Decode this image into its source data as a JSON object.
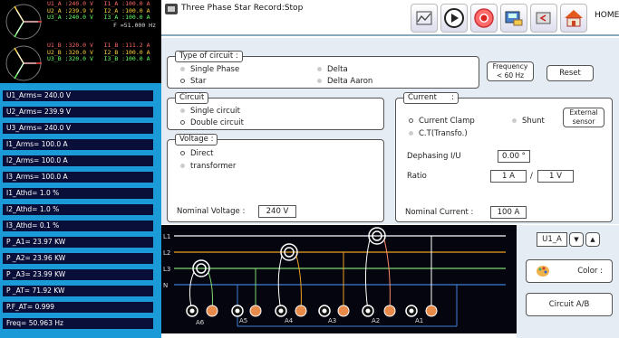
{
  "window": {
    "title": "Three Phase Star Record:Stop",
    "home_label": "HOME"
  },
  "toolbar": {
    "buttons": [
      {
        "name": "chart-icon",
        "symbol": "⚟"
      },
      {
        "name": "play-icon",
        "symbol": "▶"
      },
      {
        "name": "record-icon",
        "symbol": "●"
      },
      {
        "name": "save-icon",
        "symbol": "▤"
      },
      {
        "name": "exit-icon",
        "symbol": "⎋"
      },
      {
        "name": "home-icon",
        "symbol": "⌂"
      }
    ]
  },
  "phasor_top": {
    "lines": [
      "U1_A :240.0 V   I1_A :100.0 A",
      "U2_A :239.9 V   I2_A :100.0 A",
      "U3_A :240.0 V   I3_A :100.0 A"
    ],
    "freq": "F =51.000 Hz"
  },
  "phasor_bottom": {
    "lines": [
      "U1_B :320.0 V   I1_B :111.2 A",
      "U2_B :320.0 V   I2_B :100.0 A",
      "U3_B :320.0 V   I3_B :100.0 A"
    ]
  },
  "measurements": [
    "U1_Arms= 240.0 V",
    "U2_Arms= 239.9 V",
    "U3_Arms= 240.0 V",
    "I1_Arms= 100.0 A",
    "I2_Arms= 100.0 A",
    "I3_Arms= 100.0 A",
    "I1_Athd= 1.0 %",
    "I2_Athd= 1.0 %",
    "I3_Athd= 0.1 %",
    "P _A1= 23.97 KW",
    "P _A2= 23.96 KW",
    "P _A3= 23.99 KW",
    "P _AT= 71.92 KW",
    "P.F_AT= 0.999",
    "Freq= 50.963 Hz"
  ],
  "type_of_circuit": {
    "title": "Type of circuit :",
    "options": [
      "Single Phase",
      "Star",
      "Delta",
      "Delta Aaron"
    ],
    "selected": "Star"
  },
  "frequency_button": "Frequency\n< 60 Hz",
  "reset_button": "Reset",
  "circuit": {
    "title": "Circuit",
    "options": [
      "Single circuit",
      "Double circuit"
    ],
    "selected": "Double circuit"
  },
  "voltage": {
    "title": "Voltage :",
    "options": [
      "Direct",
      "transformer"
    ],
    "selected": "Direct",
    "nominal_label": "Nominal Voltage :",
    "nominal_value": "240 V"
  },
  "current": {
    "title": "Current      :",
    "options": [
      "Current Clamp",
      "Shunt",
      "C.T(Transfo.)"
    ],
    "selected": "Current Clamp",
    "external_sensor": "External\nsensor",
    "dephasing_label": "Dephasing I/U",
    "dephasing_value": "0.00 °",
    "ratio_label": "Ratio",
    "ratio_a": "1 A",
    "ratio_sep": "/",
    "ratio_b": "1 V",
    "nominal_label": "Nominal Current :",
    "nominal_value": "100 A"
  },
  "diagram": {
    "lines": [
      "L1",
      "L2",
      "L3",
      "N"
    ],
    "line_colors": [
      "#ffffff",
      "#f0a020",
      "#7fd86f",
      "#3f7fd8"
    ],
    "terminals": [
      "A6",
      "A5",
      "A4",
      "A3",
      "A2",
      "A1"
    ]
  },
  "side": {
    "select_value": "U1_A",
    "color_label": "Color :",
    "circuit_ab": "Circuit A/B"
  }
}
